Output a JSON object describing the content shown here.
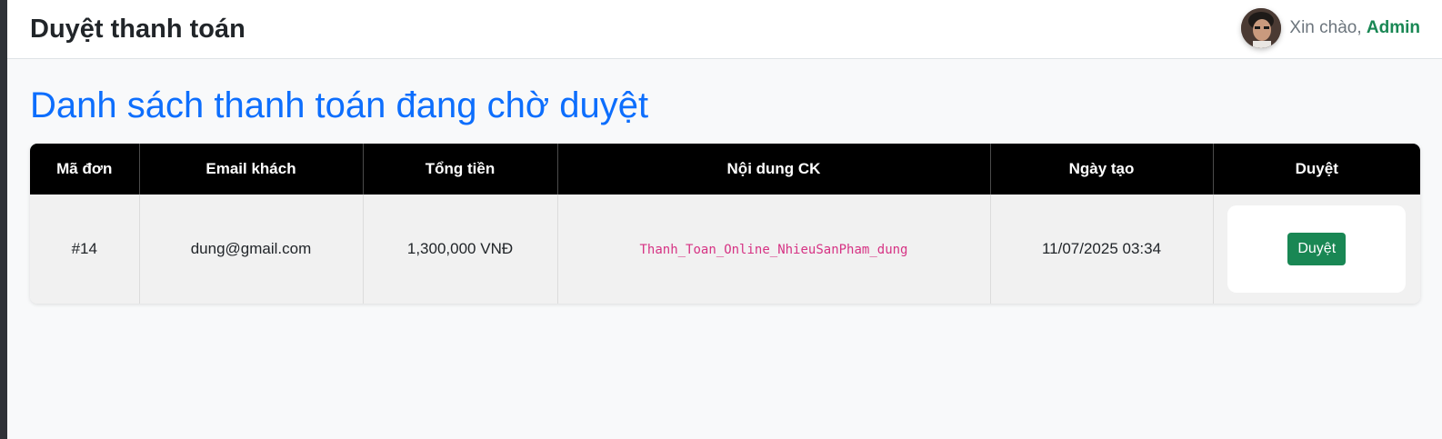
{
  "header": {
    "title": "Duyệt thanh toán",
    "greeting_prefix": "Xin chào, ",
    "username": "Admin"
  },
  "main": {
    "heading": "Danh sách thanh toán đang chờ duyệt"
  },
  "table": {
    "columns": [
      "Mã đơn",
      "Email khách",
      "Tổng tiền",
      "Nội dung CK",
      "Ngày tạo",
      "Duyệt"
    ],
    "rows": [
      {
        "order_id": "#14",
        "email": "dung@gmail.com",
        "total": "1,300,000 VNĐ",
        "transfer_note": "Thanh_Toan_Online_NhieuSanPham_dung",
        "created_at": "11/07/2025 03:34",
        "action_label": "Duyệt"
      }
    ]
  },
  "colors": {
    "heading": "#0d6efd",
    "accent_green": "#198754",
    "table_header_bg": "#000000",
    "code_pink": "#d63384"
  },
  "icons": {
    "avatar": "user-avatar-photo"
  }
}
